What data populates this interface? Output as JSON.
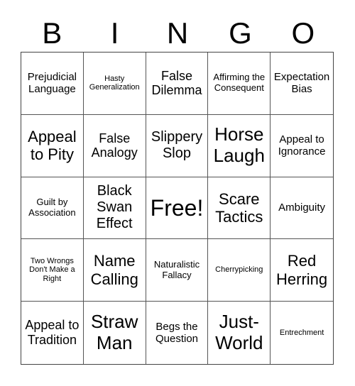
{
  "header": [
    "B",
    "I",
    "N",
    "G",
    "O"
  ],
  "cells": [
    "Prejudicial Language",
    "Hasty Generalization",
    "False Dilemma",
    "Affirming the Consequent",
    "Expectation Bias",
    "Appeal to Pity",
    "False Analogy",
    "Slippery Slop",
    "Horse Laugh",
    "Appeal to Ignorance",
    "Guilt by Association",
    "Black Swan Effect",
    "Free!",
    "Scare Tactics",
    "Ambiguity",
    "Two Wrongs Don't Make a Right",
    "Name Calling",
    "Naturalistic Fallacy",
    "Cherrypicking",
    "Red Herring",
    "Appeal to Tradition",
    "Straw Man",
    "Begs the Question",
    "Just-World",
    "Entrechment"
  ]
}
